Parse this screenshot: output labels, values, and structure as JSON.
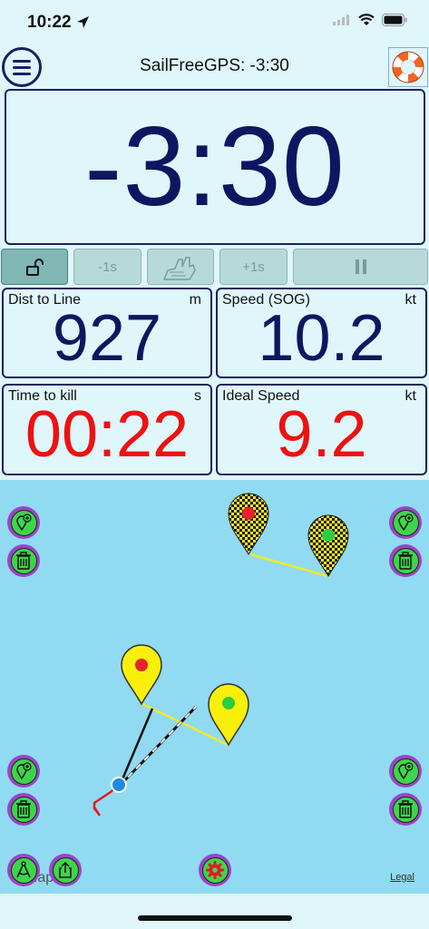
{
  "status_bar": {
    "time": "10:22",
    "icons": [
      "location-arrow-icon",
      "cellular-signal-icon",
      "wifi-icon",
      "battery-icon"
    ]
  },
  "nav": {
    "title": "SailFreeGPS: -3:30",
    "menu_icon": "hamburger-menu-icon",
    "sos_icon": "life-ring-icon"
  },
  "timer": {
    "value": "-3:30"
  },
  "controls": {
    "lock_icon": "unlocked-padlock-icon",
    "minus_label": "-1s",
    "sync_icon": "hand-sync-icon",
    "plus_label": "+1s",
    "pause_icon": "pause-icon"
  },
  "tiles": {
    "dist": {
      "label": "Dist to Line",
      "unit": "m",
      "value": "927"
    },
    "speed": {
      "label": "Speed (SOG)",
      "unit": "kt",
      "value": "10.2"
    },
    "time_to_kill": {
      "label": "Time to kill",
      "unit": "s",
      "value": "00:22"
    },
    "ideal_speed": {
      "label": "Ideal Speed",
      "unit": "kt",
      "value": "9.2"
    }
  },
  "colors": {
    "accent": "#1a2060",
    "alert": "#ee1111",
    "map_water": "#90dbf2",
    "button_green": "#3dd64a",
    "button_ring": "#9b44c8"
  },
  "map": {
    "watermark": "Map",
    "legal": "Legal",
    "buttons": {
      "add_pin_icon": "add-pin-icon",
      "trash_icon": "trash-icon",
      "compass_icon": "drafting-compass-icon",
      "share_icon": "share-icon",
      "settings_icon": "gear-icon"
    }
  }
}
